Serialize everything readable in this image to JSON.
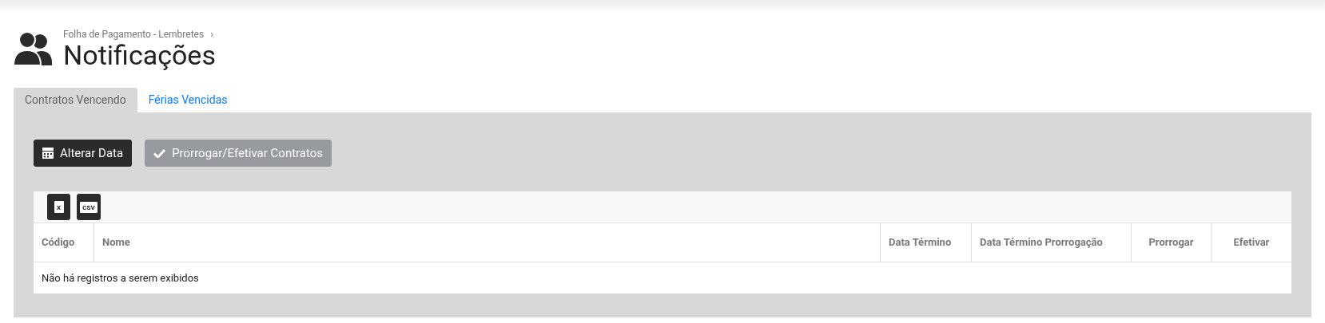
{
  "breadcrumb": {
    "label": "Folha de Pagamento - Lembretes",
    "separator": "›"
  },
  "title": "Notificações",
  "tabs": [
    {
      "label": "Contratos Vencendo",
      "selected": true
    },
    {
      "label": "Férias Vencidas",
      "selected": false
    }
  ],
  "actions": [
    {
      "label": "Alterar Data",
      "kind": "calendar",
      "disabled": false
    },
    {
      "label": "Prorrogar/Efetivar Contratos",
      "kind": "check",
      "disabled": true
    }
  ],
  "export_buttons": [
    {
      "kind": "excel",
      "icon_text": "X"
    },
    {
      "kind": "csv",
      "icon_text": "CSV"
    }
  ],
  "table": {
    "columns": [
      {
        "label": "Código"
      },
      {
        "label": "Nome"
      },
      {
        "label": "Data Término"
      },
      {
        "label": "Data Término Prorrogação"
      },
      {
        "label": "Prorrogar"
      },
      {
        "label": "Efetivar"
      }
    ],
    "empty_message": "Não há registros a serem exibidos"
  }
}
